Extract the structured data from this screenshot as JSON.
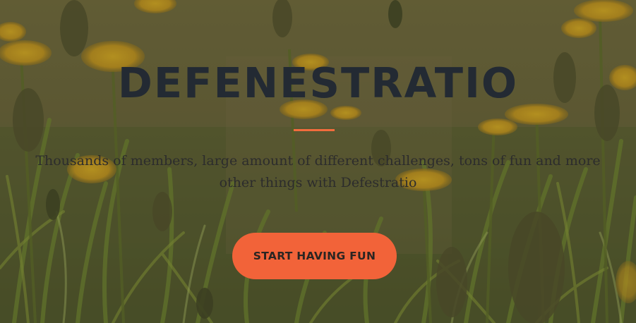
{
  "hero": {
    "title": "DEFENESTRATIO",
    "subtitle": "Thousands of members, large amount of different challenges, tons of fun and more other things with Defestratio",
    "cta_label": "START HAVING FUN",
    "background_image": "dandelion-field-photo"
  },
  "colors": {
    "accent": "#f26339",
    "title": "#232a33",
    "subtitle": "#2c2c2c"
  }
}
